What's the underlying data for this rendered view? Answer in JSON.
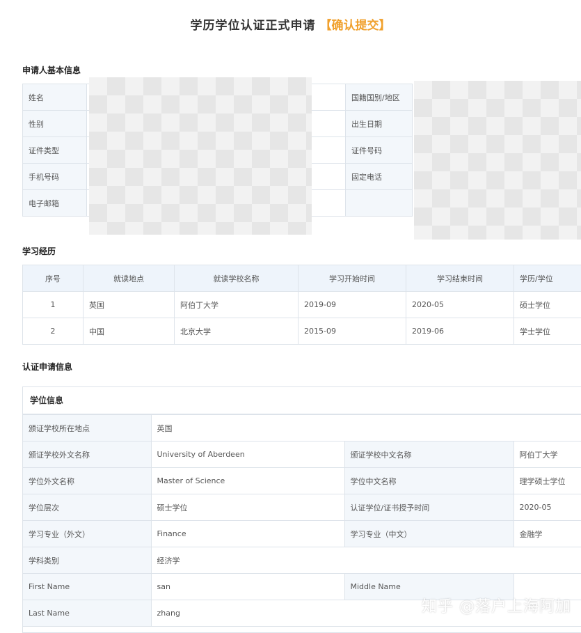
{
  "page": {
    "title": "学历学位认证正式申请",
    "status_tag": "【确认提交】"
  },
  "applicant": {
    "section_title": "申请人基本信息",
    "left_labels": [
      "姓名",
      "性别",
      "证件类型",
      "手机号码",
      "电子邮箱"
    ],
    "right_labels": [
      "国籍国别/地区",
      "出生日期",
      "证件号码",
      "固定电话",
      ""
    ]
  },
  "study": {
    "section_title": "学习经历",
    "headers": [
      "序号",
      "就读地点",
      "就读学校名称",
      "学习开始时间",
      "学习结束时间",
      "学历/学位"
    ],
    "rows": [
      [
        "1",
        "英国",
        "阿伯丁大学",
        "2019-09",
        "2020-05",
        "硕士学位"
      ],
      [
        "2",
        "中国",
        "北京大学",
        "2015-09",
        "2019-06",
        "学士学位"
      ]
    ]
  },
  "certification": {
    "section_title": "认证申请信息",
    "box_title": "学位信息",
    "school_location_label": "颁证学校所在地点",
    "school_location_value": "英国",
    "rows": [
      {
        "l1": "颁证学校外文名称",
        "v1": "University of Aberdeen",
        "l2": "颁证学校中文名称",
        "v2": "阿伯丁大学"
      },
      {
        "l1": "学位外文名称",
        "v1": "Master of Science",
        "l2": "学位中文名称",
        "v2": "理学硕士学位"
      },
      {
        "l1": "学位层次",
        "v1": "硕士学位",
        "l2": "认证学位/证书授予时间",
        "v2": "2020-05"
      },
      {
        "l1": "学习专业（外文）",
        "v1": "Finance",
        "l2": "学习专业（中文）",
        "v2": "金融学"
      }
    ],
    "subject_label": "学科类别",
    "subject_value": "经济学",
    "first_name_label": "First Name",
    "first_name_value": "san",
    "middle_name_label": "Middle Name",
    "middle_name_value": "",
    "last_name_label": "Last Name",
    "last_name_value": "zhang"
  },
  "watermark": "知乎 @落户上海阿加"
}
